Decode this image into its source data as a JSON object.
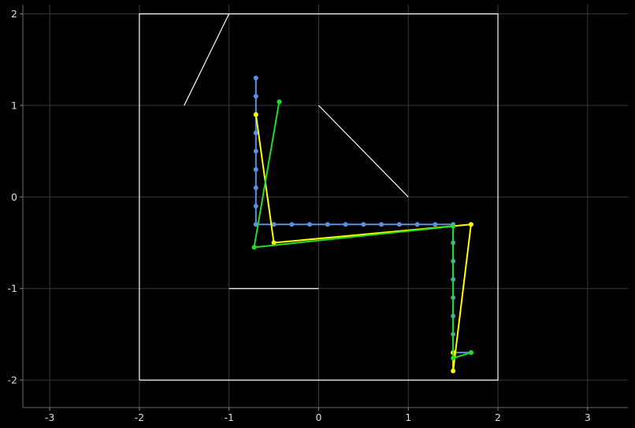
{
  "chart_data": {
    "type": "line",
    "title": "",
    "xlabel": "",
    "ylabel": "",
    "xlim": [
      -3.3,
      3.45
    ],
    "ylim": [
      -2.3,
      2.1
    ],
    "x_ticks": [
      -3,
      -2,
      -1,
      0,
      1,
      2,
      3
    ],
    "y_ticks": [
      -2,
      -1,
      0,
      1,
      2
    ],
    "x_tick_labels": [
      "-3",
      "-2",
      "-1",
      "0",
      "1",
      "2",
      "3"
    ],
    "y_tick_labels": [
      "-2",
      "-1",
      "0",
      "1",
      "2"
    ],
    "grid": true,
    "legend": "none",
    "background_color": "#000000",
    "grid_color": "#3a3a3a",
    "shapes": [
      {
        "color": "#ffffff",
        "points": [
          [
            -2,
            -2
          ],
          [
            -2,
            2
          ],
          [
            2,
            2
          ],
          [
            2,
            -2
          ],
          [
            -2,
            -2
          ]
        ]
      },
      {
        "color": "#ffffff",
        "points": [
          [
            -1.5,
            1
          ],
          [
            -1,
            2
          ]
        ]
      },
      {
        "color": "#ffffff",
        "points": [
          [
            0,
            1
          ],
          [
            1,
            0
          ]
        ]
      },
      {
        "color": "#ffffff",
        "points": [
          [
            -1,
            -1
          ],
          [
            0,
            -1
          ]
        ]
      }
    ],
    "series": [
      {
        "color": "#5b8fe0",
        "markers": true,
        "points": [
          [
            -0.7,
            1.3
          ],
          [
            -0.7,
            1.1
          ],
          [
            -0.7,
            0.9
          ],
          [
            -0.7,
            0.7
          ],
          [
            -0.7,
            0.5
          ],
          [
            -0.7,
            0.3
          ],
          [
            -0.7,
            0.1
          ],
          [
            -0.7,
            -0.1
          ],
          [
            -0.7,
            -0.3
          ],
          [
            -0.5,
            -0.3
          ],
          [
            -0.3,
            -0.3
          ],
          [
            -0.1,
            -0.3
          ],
          [
            0.1,
            -0.3
          ],
          [
            0.3,
            -0.3
          ],
          [
            0.5,
            -0.3
          ],
          [
            0.7,
            -0.3
          ],
          [
            0.9,
            -0.3
          ],
          [
            1.1,
            -0.3
          ],
          [
            1.3,
            -0.3
          ],
          [
            1.5,
            -0.3
          ],
          [
            1.5,
            -0.5
          ],
          [
            1.5,
            -0.7
          ],
          [
            1.5,
            -0.9
          ],
          [
            1.5,
            -1.1
          ],
          [
            1.5,
            -1.3
          ],
          [
            1.5,
            -1.5
          ],
          [
            1.5,
            -1.7
          ],
          [
            1.7,
            -1.7
          ]
        ]
      },
      {
        "color": "#ffff00",
        "markers": true,
        "points": [
          [
            -0.7,
            0.9
          ],
          [
            -0.5,
            -0.5
          ],
          [
            1.7,
            -0.3
          ],
          [
            1.5,
            -1.9
          ],
          [
            1.5,
            -1.7
          ]
        ]
      },
      {
        "color": "#22dd22",
        "markers": true,
        "points": [
          [
            -0.44,
            1.04
          ],
          [
            -0.72,
            -0.55
          ],
          [
            1.5,
            -0.32
          ],
          [
            1.5,
            -1.76
          ],
          [
            1.7,
            -1.7
          ]
        ]
      }
    ]
  }
}
